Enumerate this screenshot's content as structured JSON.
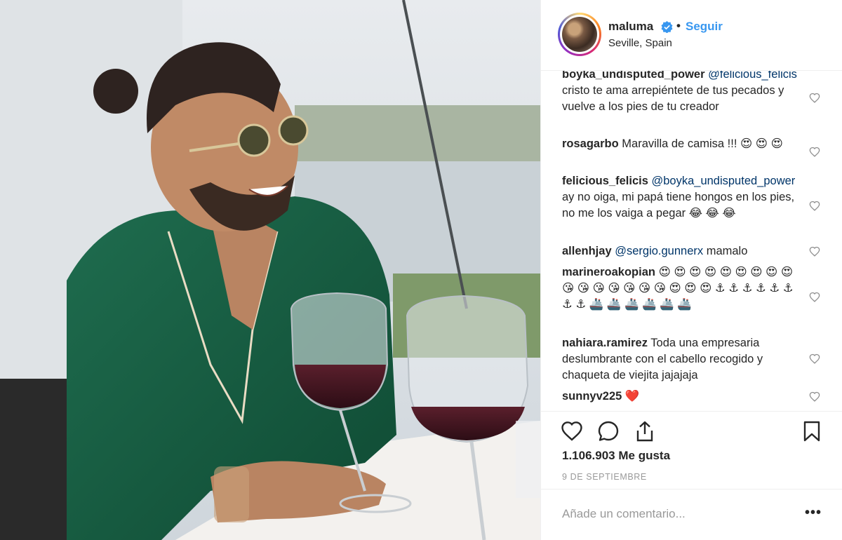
{
  "post": {
    "username": "maluma",
    "dot": "•",
    "follow_label": "Seguir",
    "location": "Seville, Spain",
    "icons": [
      "verified-badge-icon",
      "heart-icon",
      "comment-icon",
      "share-icon",
      "bookmark-icon",
      "more-options-icon"
    ]
  },
  "comments": [
    {
      "user": "boyka_undisputed_power",
      "mention": "@felicious_felicis",
      "text": "cristo te ama arrepiéntete de tus pecados y vuelve a los pies de tu creador"
    },
    {
      "user": "rosagarbo",
      "mention": "",
      "text": "Maravilla de camisa !!! 😍 😍 😍"
    },
    {
      "user": "felicious_felicis",
      "mention": "@boyka_undisputed_power",
      "text": "ay no oiga, mi papá tiene hongos en los pies, no me los vaiga a pegar 😂 😂 😂"
    },
    {
      "user": "allenhjay",
      "mention": "@sergio.gunnerx",
      "text": "mamalo"
    },
    {
      "user": "marineroakopian",
      "mention": "",
      "text": "😍 😍 😍 😍 😍 😍 😍 😍 😍 😘 😘 😘 😘 😘 😘 😘 😍 😍 😍 ⚓ ⚓ ⚓ ⚓ ⚓ ⚓ ⚓ ⚓ 🚢 🚢 🚢 🚢 🚢 🚢"
    },
    {
      "user": "nahiara.ramirez",
      "mention": "",
      "text": "Toda una empresaria deslumbrante con el cabello recogido y chaqueta de viejita jajajaja"
    },
    {
      "user": "sunnyv225",
      "mention": "",
      "text": "❤️"
    }
  ],
  "likes": "1.106.903 Me gusta",
  "date": "9 DE SEPTIEMBRE",
  "add_comment_placeholder": "Añade un comentario...",
  "more_label": "•••",
  "colors": {
    "link": "#3897f0",
    "mention": "#003569",
    "text": "#262626",
    "muted": "#999999",
    "border": "#efefef"
  }
}
